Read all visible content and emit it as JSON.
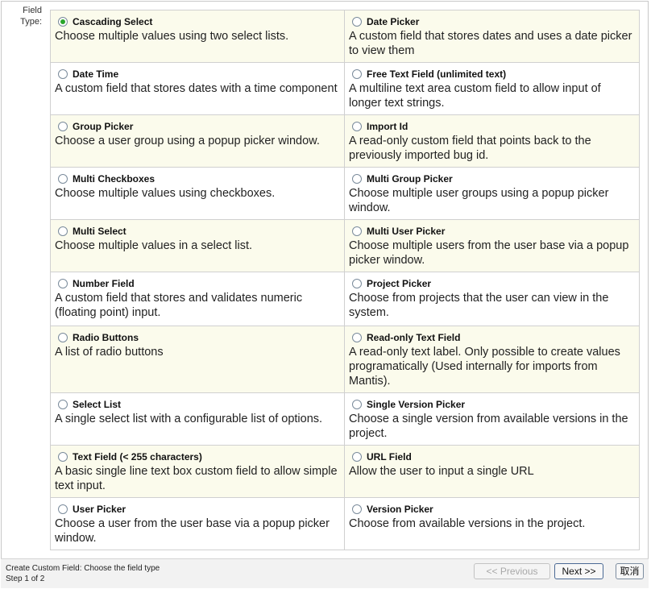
{
  "form": {
    "field_type_label": "Field Type:"
  },
  "options": [
    [
      {
        "title": "Cascading Select",
        "desc": "Choose multiple values using two select lists.",
        "checked": true
      },
      {
        "title": "Date Picker",
        "desc": "A custom field that stores dates and uses a date picker to view them",
        "checked": false
      }
    ],
    [
      {
        "title": "Date Time",
        "desc": "A custom field that stores dates with a time component",
        "checked": false
      },
      {
        "title": "Free Text Field (unlimited text)",
        "desc": "A multiline text area custom field to allow input of longer text strings.",
        "checked": false
      }
    ],
    [
      {
        "title": "Group Picker",
        "desc": "Choose a user group using a popup picker window.",
        "checked": false
      },
      {
        "title": "Import Id",
        "desc": "A read-only custom field that points back to the previously imported bug id.",
        "checked": false
      }
    ],
    [
      {
        "title": "Multi Checkboxes",
        "desc": "Choose multiple values using checkboxes.",
        "checked": false
      },
      {
        "title": "Multi Group Picker",
        "desc": "Choose multiple user groups using a popup picker window.",
        "checked": false
      }
    ],
    [
      {
        "title": "Multi Select",
        "desc": "Choose multiple values in a select list.",
        "checked": false
      },
      {
        "title": "Multi User Picker",
        "desc": "Choose multiple users from the user base via a popup picker window.",
        "checked": false
      }
    ],
    [
      {
        "title": "Number Field",
        "desc": "A custom field that stores and validates numeric (floating point) input.",
        "checked": false
      },
      {
        "title": "Project Picker",
        "desc": "Choose from projects that the user can view in the system.",
        "checked": false
      }
    ],
    [
      {
        "title": "Radio Buttons",
        "desc": "A list of radio buttons",
        "checked": false
      },
      {
        "title": "Read-only Text Field",
        "desc": "A read-only text label. Only possible to create values programatically (Used internally for imports from Mantis).",
        "checked": false
      }
    ],
    [
      {
        "title": "Select List",
        "desc": "A single select list with a configurable list of options.",
        "checked": false
      },
      {
        "title": "Single Version Picker",
        "desc": "Choose a single version from available versions in the project.",
        "checked": false
      }
    ],
    [
      {
        "title": "Text Field (< 255 characters)",
        "desc": "A basic single line text box custom field to allow simple text input.",
        "checked": false
      },
      {
        "title": "URL Field",
        "desc": "Allow the user to input a single URL",
        "checked": false
      }
    ],
    [
      {
        "title": "User Picker",
        "desc": "Choose a user from the user base via a popup picker window.",
        "checked": false
      },
      {
        "title": "Version Picker",
        "desc": "Choose from available versions in the project.",
        "checked": false
      }
    ]
  ],
  "footer": {
    "status_line1": "Create Custom Field: Choose the field type",
    "status_line2": "Step 1 of 2",
    "previous_label": "<< Previous",
    "next_label": "Next >>",
    "cancel_label": "取消"
  }
}
